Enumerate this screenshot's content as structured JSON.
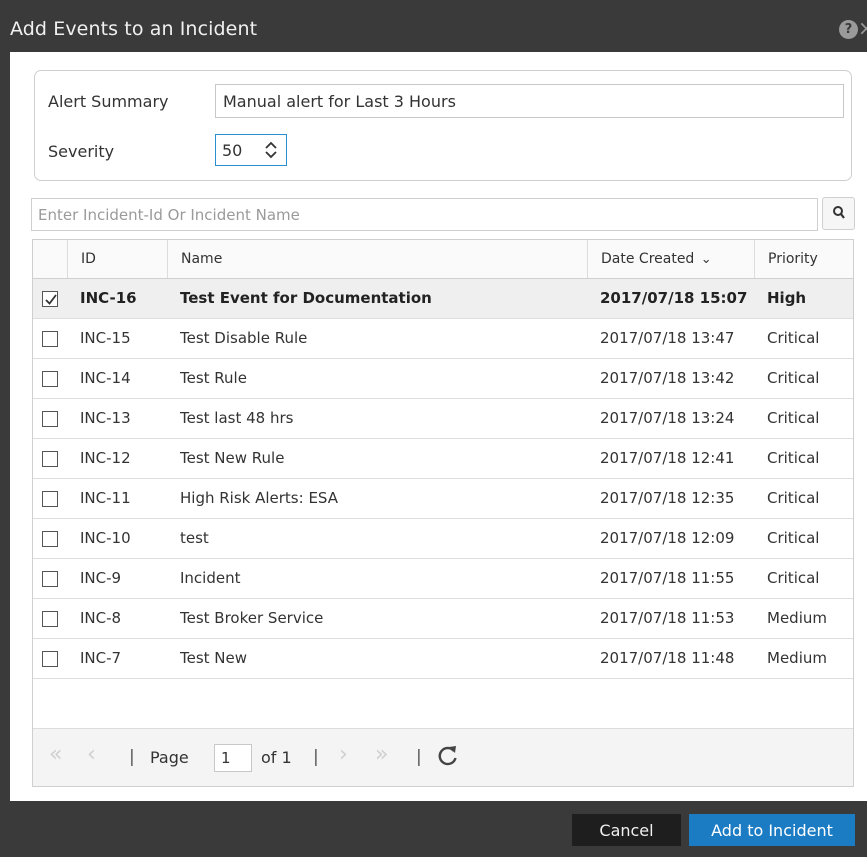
{
  "dialog": {
    "title": "Add Events to an Incident",
    "help_icon": "?",
    "close_icon": "×"
  },
  "form": {
    "summary_label": "Alert Summary",
    "summary_value": "Manual alert for Last 3 Hours",
    "severity_label": "Severity",
    "severity_value": "50"
  },
  "search": {
    "placeholder": "Enter Incident-Id Or Incident Name",
    "value": ""
  },
  "table": {
    "columns": [
      {
        "label": "ID"
      },
      {
        "label": "Name"
      },
      {
        "label": "Date Created",
        "sort_indicator": "⌄"
      },
      {
        "label": "Priority"
      }
    ],
    "rows": [
      {
        "id": "INC-16",
        "name": "Test Event for Documentation",
        "date": "2017/07/18 15:07",
        "priority": "High",
        "selected": true
      },
      {
        "id": "INC-15",
        "name": "Test Disable Rule",
        "date": "2017/07/18 13:47",
        "priority": "Critical",
        "selected": false
      },
      {
        "id": "INC-14",
        "name": "Test Rule",
        "date": "2017/07/18 13:42",
        "priority": "Critical",
        "selected": false
      },
      {
        "id": "INC-13",
        "name": "Test last 48 hrs",
        "date": "2017/07/18 13:24",
        "priority": "Critical",
        "selected": false
      },
      {
        "id": "INC-12",
        "name": "Test New Rule",
        "date": "2017/07/18 12:41",
        "priority": "Critical",
        "selected": false
      },
      {
        "id": "INC-11",
        "name": "High Risk Alerts: ESA",
        "date": "2017/07/18 12:35",
        "priority": "Critical",
        "selected": false
      },
      {
        "id": "INC-10",
        "name": "test",
        "date": "2017/07/18 12:09",
        "priority": "Critical",
        "selected": false
      },
      {
        "id": "INC-9",
        "name": "Incident",
        "date": "2017/07/18 11:55",
        "priority": "Critical",
        "selected": false
      },
      {
        "id": "INC-8",
        "name": "Test Broker Service",
        "date": "2017/07/18 11:53",
        "priority": "Medium",
        "selected": false
      },
      {
        "id": "INC-7",
        "name": "Test New",
        "date": "2017/07/18 11:48",
        "priority": "Medium",
        "selected": false
      }
    ]
  },
  "pager": {
    "first_glyph": "«",
    "prev_glyph": "‹",
    "next_glyph": "›",
    "last_glyph": "»",
    "separator": "|",
    "page_label": "Page",
    "page_value": "1",
    "of_label": "of 1"
  },
  "footer": {
    "cancel_label": "Cancel",
    "add_label": "Add to Incident"
  },
  "colors": {
    "chrome": "#3a3a3a",
    "primary_button": "#1b7cc4",
    "focus_border": "#2a8fd0",
    "selected_row": "#efefef"
  },
  "icons": {
    "help": "help-icon",
    "close": "close-icon",
    "search": "search-icon",
    "stepper": "stepper-icon",
    "refresh": "refresh-icon",
    "checkbox_checked": "checkbox-checked-icon",
    "sort": "chevron-down-icon"
  }
}
